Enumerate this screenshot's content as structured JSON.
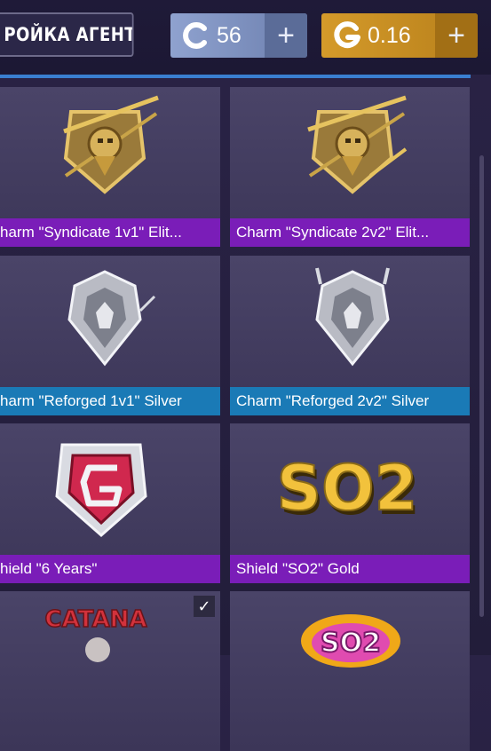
{
  "header": {
    "agent_button_label": "РОЙКА АГЕНТА",
    "credits": {
      "value": "56",
      "plus": "+",
      "icon": "c-coin-icon",
      "color": "#8fa2cf"
    },
    "gold": {
      "value": "0.16",
      "plus": "+",
      "icon": "g-coin-icon",
      "color": "#d49a2a"
    }
  },
  "items": [
    {
      "label": "harm \"Syndicate 1v1\" Elit...",
      "rarity": "purple",
      "icon": "syndicate-charm-icon"
    },
    {
      "label": "Charm \"Syndicate 2v2\" Elit...",
      "rarity": "purple",
      "icon": "syndicate-charm-icon"
    },
    {
      "label": "harm \"Reforged 1v1\" Silver",
      "rarity": "blue",
      "icon": "reforged-charm-icon"
    },
    {
      "label": "Charm \"Reforged 2v2\" Silver",
      "rarity": "blue",
      "icon": "reforged-charm-icon"
    },
    {
      "label": "hield \"6 Years\"",
      "rarity": "purple",
      "icon": "six-years-shield-icon"
    },
    {
      "label": "Shield \"SO2\" Gold",
      "rarity": "purple",
      "icon": "so2-gold-shield-icon"
    },
    {
      "label": "",
      "rarity": "",
      "icon": "catana-sticker-icon",
      "selected": true
    },
    {
      "label": "",
      "rarity": "",
      "icon": "so2-pink-sticker-icon"
    }
  ],
  "so2_text": "SO2",
  "catana_text": "CATANA",
  "checkmark": "✓"
}
